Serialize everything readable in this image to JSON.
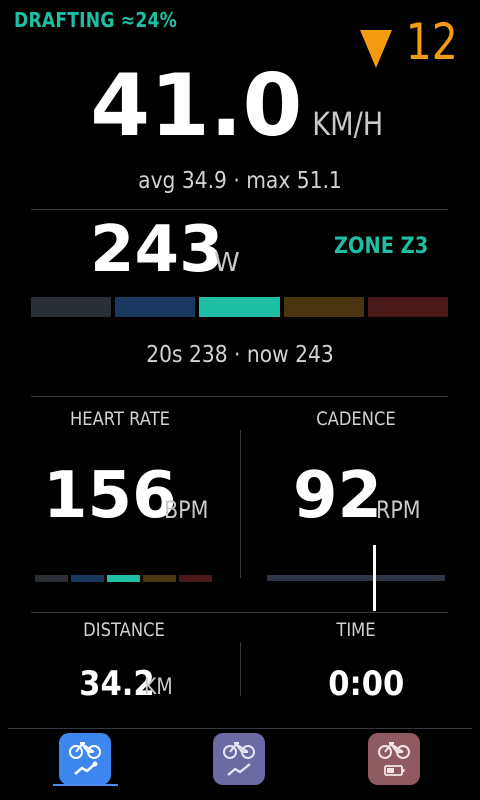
{
  "status": {
    "drafting": "DRAFTING ≈24%",
    "position_icon": "triangle-down-icon",
    "position_change": "12"
  },
  "speed": {
    "value": "41.0",
    "unit": "KM/H",
    "stats": "avg 34.9 · max 51.1"
  },
  "power": {
    "value": "243",
    "unit": "W",
    "zone": "ZONE Z3",
    "stats": "20s 238 · now 243",
    "zone_colors": [
      "#2a2e35",
      "#19375f",
      "#1fbfa6",
      "#4a3510",
      "#4a1a1a"
    ],
    "active_zone": 3
  },
  "heart_rate": {
    "label": "HEART RATE",
    "value": "156",
    "unit": "BPM",
    "zone_colors": [
      "#2a2e35",
      "#19375f",
      "#1fbfa6",
      "#4a3510",
      "#4a1a1a"
    ]
  },
  "cadence": {
    "label": "CADENCE",
    "value": "92",
    "unit": "RPM",
    "level": 0.6
  },
  "distance": {
    "label": "DISTANCE",
    "value": "34.2",
    "unit": "KM"
  },
  "time": {
    "label": "TIME",
    "value": "0:00"
  },
  "tabs": [
    {
      "icon": "bike-chart-icon",
      "color": "#3d86f0",
      "active": true
    },
    {
      "icon": "bike-trend-icon",
      "color": "#6b6aa3",
      "active": false
    },
    {
      "icon": "bike-battery-icon",
      "color": "#8f5a61",
      "active": false
    }
  ]
}
